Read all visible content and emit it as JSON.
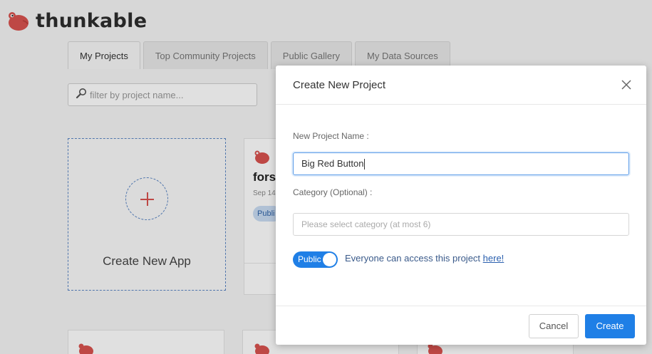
{
  "app": {
    "brand": "thunkable",
    "tabs": [
      {
        "label": "My Projects"
      },
      {
        "label": "Top Community Projects"
      },
      {
        "label": "Public Gallery"
      },
      {
        "label": "My Data Sources"
      }
    ],
    "filter_placeholder": "filter by project name...",
    "create_card_label": "Create New App",
    "project_card": {
      "title": "forsc",
      "date": "Sep 14",
      "badge": "Publi"
    }
  },
  "modal": {
    "title": "Create New Project",
    "name_label": "New Project Name :",
    "name_value": "Big Red Button",
    "category_label": "Category (Optional) :",
    "category_placeholder": "Please select category (at most 6)",
    "toggle_label": "Public",
    "toggle_description": "Everyone can access this project ",
    "toggle_link": "here!",
    "cancel_label": "Cancel",
    "create_label": "Create"
  },
  "colors": {
    "accent": "#1f7fe6",
    "brand_red": "#d9534f",
    "dashed_border": "#5b86c4"
  }
}
